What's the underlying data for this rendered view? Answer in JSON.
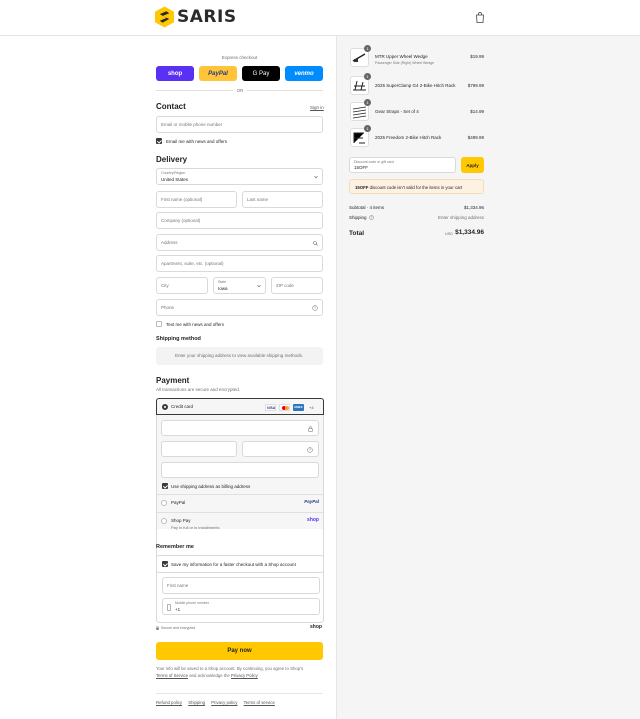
{
  "brand": {
    "name": "SARIS"
  },
  "express": {
    "title": "Express checkout",
    "buttons": [
      "shop",
      "PayPal",
      "G Pay",
      "venmo"
    ],
    "or": "OR"
  },
  "contact": {
    "title": "Contact",
    "sign_in": "Sign in",
    "email_placeholder": "Email or mobile phone number",
    "email_news": "Email me with news and offers"
  },
  "delivery": {
    "title": "Delivery",
    "country_label": "Country/Region",
    "country_value": "United States",
    "first_name": "First name (optional)",
    "last_name": "Last name",
    "company": "Company (optional)",
    "address": "Address",
    "apartment": "Apartment, suite, etc. (optional)",
    "city": "City",
    "state_label": "State",
    "state_value": "Iowa",
    "zip": "ZIP code",
    "phone": "Phone",
    "text_news": "Text me with news and offers"
  },
  "shipping_method": {
    "title": "Shipping method",
    "message": "Enter your shipping address to view available shipping methods."
  },
  "payment": {
    "title": "Payment",
    "subtitle": "All transactions are secure and encrypted.",
    "credit_card": "Credit card",
    "card_more": "+4",
    "billing_same": "Use shipping address as billing address",
    "paypal": "PayPal",
    "paypal_logo": "PayPal",
    "shop_pay": "Shop Pay",
    "shop_pay_sub": "Pay in full or in installments",
    "shop_logo": "shop"
  },
  "remember": {
    "title": "Remember me",
    "save_info": "Save my information for a faster checkout with a Shop account",
    "first_name": "First name",
    "mobile_label": "Mobile phone number",
    "mobile_value": "+1",
    "secure": "Secure and encrypted",
    "shop_logo": "shop"
  },
  "pay_button": "Pay now",
  "legal": {
    "text1": "Your info will be saved to a Shop account. By continuing, you agree to Shop's",
    "tos": "Terms of Service",
    "text2": "and acknowledge the",
    "privacy": "Privacy Policy"
  },
  "footer_links": [
    "Refund policy",
    "Shipping",
    "Privacy policy",
    "Terms of service"
  ],
  "cart": {
    "items": [
      {
        "name": "MTR Upper Wheel Wedge",
        "sub": "Passenger Side (Right) Wheel Wedge",
        "price": "$19.99",
        "qty": "1"
      },
      {
        "name": "2025 SuperClamp G4 2-Bike Hitch Rack",
        "sub": "",
        "price": "$799.99",
        "qty": "1"
      },
      {
        "name": "Gear Straps - Set of 4",
        "sub": "",
        "price": "$14.99",
        "qty": "1"
      },
      {
        "name": "2025 Freedom 2-Bike Hitch Rack",
        "sub": "",
        "price": "$499.99",
        "qty": "1"
      }
    ],
    "discount_label": "Discount code or gift card",
    "discount_value": "15OFF",
    "apply": "Apply",
    "error_code": "15OFF",
    "error_text": "discount code isn't valid for the items in your cart",
    "subtotal_label": "Subtotal · 4 items",
    "subtotal_value": "$1,334.96",
    "shipping_label": "Shipping",
    "shipping_value": "Enter shipping address",
    "total_label": "Total",
    "currency": "USD",
    "total_value": "$1,334.96"
  },
  "colors": {
    "accent_yellow": "#ffc800",
    "shop_purple": "#5a31f4",
    "venmo_blue": "#008cff",
    "paypal_yellow": "#ffc439"
  }
}
